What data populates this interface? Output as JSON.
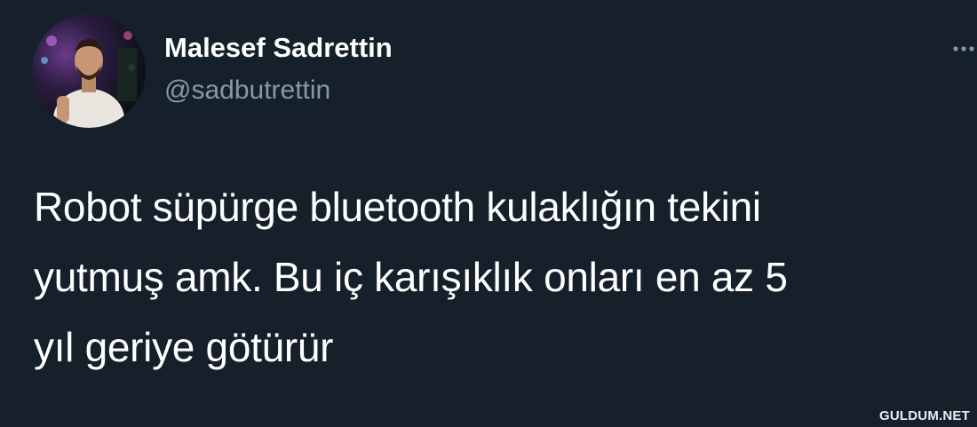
{
  "author": {
    "display_name": "Malesef Sadrettin",
    "handle": "@sadbutrettin"
  },
  "tweet": {
    "lines": [
      "Robot süpürge bluetooth kulaklığın tekini",
      "yutmuş amk. Bu iç karışıklık onları en az 5",
      "yıl geriye götürür"
    ]
  },
  "more_icon": "more-horizontal-icon",
  "watermark": "GULDUM.NET",
  "colors": {
    "background": "#15202b",
    "text_primary": "#ffffff",
    "text_secondary": "#8899a6"
  }
}
